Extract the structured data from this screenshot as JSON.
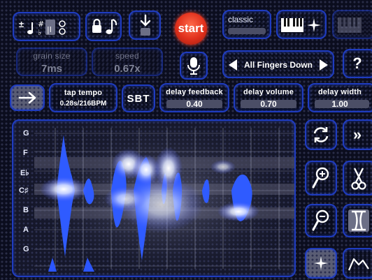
{
  "top_bar": {
    "start_label": "start",
    "mode_label": "classic"
  },
  "params_row": {
    "grain_size": {
      "label": "grain size",
      "value": "7ms"
    },
    "speed": {
      "label": "speed",
      "value": "0.67x"
    },
    "finger_mode": "All Fingers Down",
    "help_label": "?"
  },
  "controls_row": {
    "tap_tempo": {
      "label": "tap tempo",
      "value": "0.28s/216BPM"
    },
    "sbt_label": "SBT",
    "delay_feedback": {
      "label": "delay feedback",
      "value": "0.40"
    },
    "delay_volume": {
      "label": "delay volume",
      "value": "0.70"
    },
    "delay_width": {
      "label": "delay width",
      "value": "1.00"
    }
  },
  "note_axis": [
    "G",
    "F",
    "E♭",
    "C♯",
    "B",
    "A",
    "G"
  ],
  "side_tools": {
    "forward_label": "»"
  },
  "colors": {
    "panel_border": "#1f3cc0",
    "waveform": "#2f5bff",
    "start_button": "#e0301c"
  }
}
